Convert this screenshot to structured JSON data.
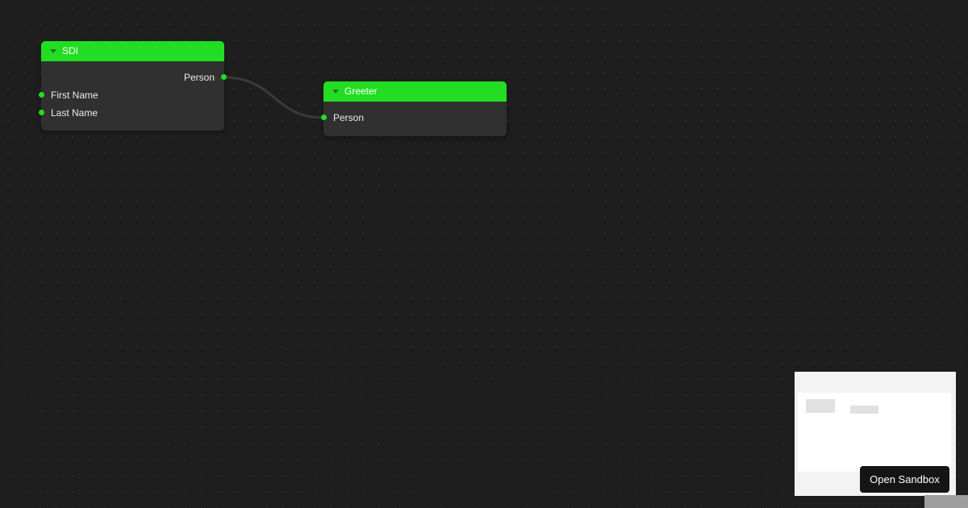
{
  "colors": {
    "canvas_background": "#1e1e1e",
    "node_header": "#22dd22",
    "node_body": "#303030",
    "port": "#22dd22",
    "connection": "#3a3a3a",
    "button_background": "#151515"
  },
  "nodes": {
    "sdi": {
      "title": "SDI",
      "outputs": [
        "Person"
      ],
      "inputs": [
        "First Name",
        "Last Name"
      ]
    },
    "greeter": {
      "title": "Greeter",
      "inputs": [
        "Person"
      ]
    }
  },
  "connections": [
    {
      "from": "SDI.Person",
      "to": "Greeter.Person"
    }
  ],
  "minimap": {
    "icon": "minimap-preview"
  },
  "sandbox_button": {
    "label": "Open Sandbox"
  }
}
